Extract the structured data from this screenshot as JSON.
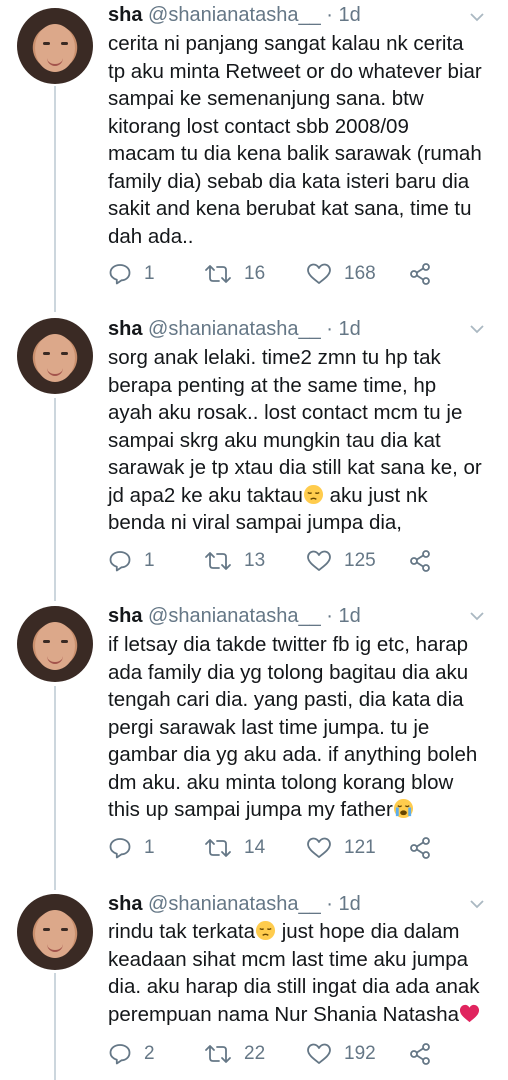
{
  "tweets": [
    {
      "name": "sha",
      "handle": "@shanianatasha__",
      "dot": "·",
      "time": "1d",
      "lines": [
        "cerita ni panjang sangat kalau nk cerita",
        "tp aku minta Retweet or do whatever biar",
        "sampai ke semenanjung sana. btw",
        "kitorang lost contact sbb 2008/09",
        "macam tu dia kena balik sarawak (rumah",
        "family dia) sebab dia kata isteri baru dia",
        "sakit and kena berubat kat sana, time tu",
        "dah ada.."
      ],
      "replies": "1",
      "retweets": "16",
      "likes": "168"
    },
    {
      "name": "sha",
      "handle": "@shanianatasha__",
      "dot": "·",
      "time": "1d",
      "lines": [
        "sorg anak lelaki. time2 zmn tu hp tak",
        "berapa penting at the same time, hp",
        "ayah aku rosak.. lost contact mcm tu je",
        "sampai skrg aku mungkin tau dia kat",
        "sarawak je tp xtau dia still kat sana ke, or",
        "jd apa2 ke aku taktau",
        "benda ni viral sampai jumpa dia,"
      ],
      "line6_after_emoji": " aku just nk",
      "replies": "1",
      "retweets": "13",
      "likes": "125"
    },
    {
      "name": "sha",
      "handle": "@shanianatasha__",
      "dot": "·",
      "time": "1d",
      "lines": [
        "if letsay dia takde twitter fb ig etc, harap",
        "ada family dia yg tolong bagitau dia aku",
        "tengah cari dia. yang pasti, dia kata dia",
        "pergi sarawak last time jumpa. tu je",
        "gambar dia yg aku ada. if anything boleh",
        "dm aku. aku minta tolong korang blow",
        "this up sampai jumpa my father"
      ],
      "replies": "1",
      "retweets": "14",
      "likes": "121"
    },
    {
      "name": "sha",
      "handle": "@shanianatasha__",
      "dot": "·",
      "time": "1d",
      "lines": [
        "rindu tak terkata",
        "keadaan sihat mcm last time aku jumpa",
        "dia. aku harap dia still ingat dia ada anak",
        "perempuan nama Nur Shania Natasha"
      ],
      "line1_after_emoji": " just hope dia dalam",
      "replies": "2",
      "retweets": "22",
      "likes": "192"
    }
  ],
  "icons": {
    "reply": "reply-icon",
    "retweet": "retweet-icon",
    "like": "heart-icon",
    "share": "share-icon",
    "more": "chevron-down-icon"
  },
  "colors": {
    "text": "#14171a",
    "secondary": "#657786",
    "thread": "#ccd6dd",
    "heart_emoji": "#e0245e"
  }
}
